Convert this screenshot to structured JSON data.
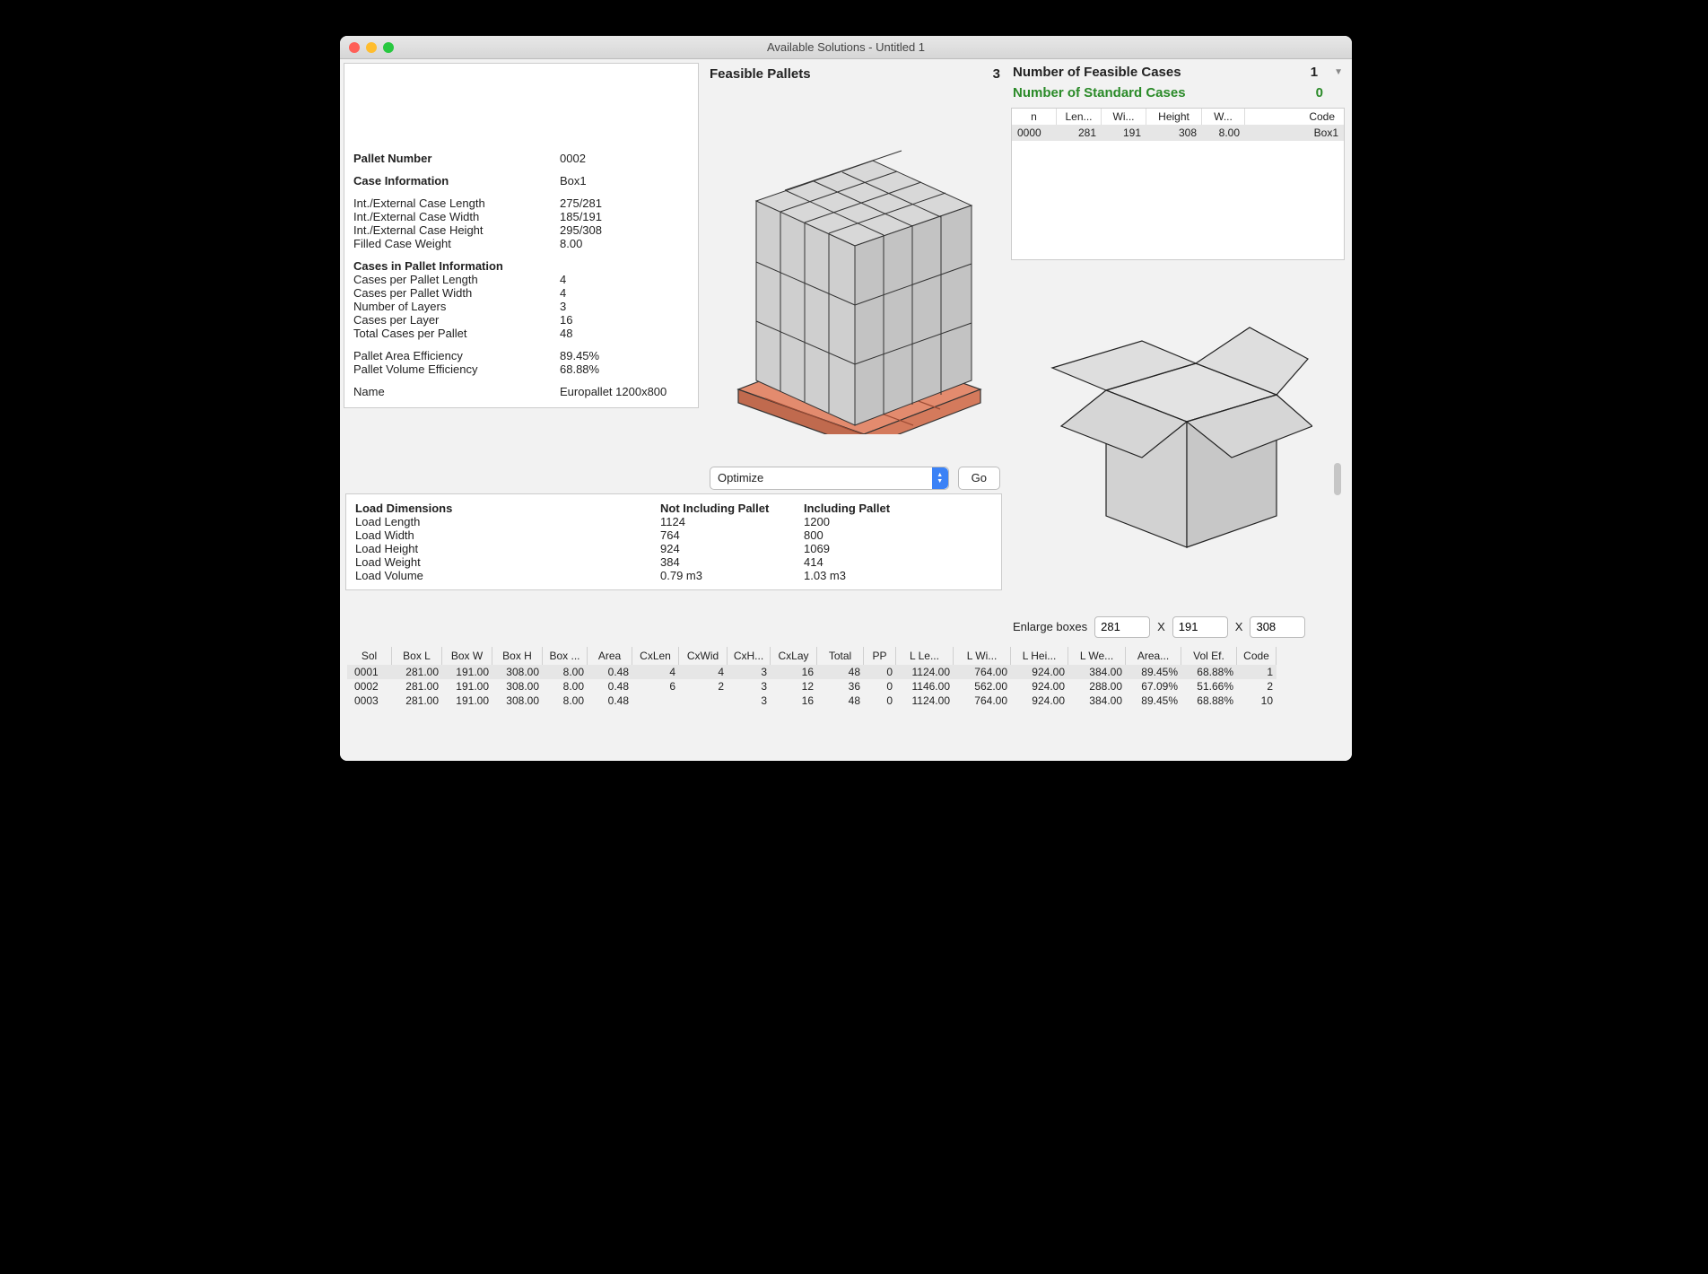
{
  "window": {
    "title": "Available Solutions - Untitled 1"
  },
  "left": {
    "pallet_number_lbl": "Pallet Number",
    "pallet_number": "0002",
    "case_info_lbl": "Case Information",
    "case_info": "Box1",
    "len_lbl": "Int./External Case Length",
    "len_val": "275/281",
    "wid_lbl": "Int./External Case Width",
    "wid_val": "185/191",
    "hei_lbl": "Int./External Case Height",
    "hei_val": "295/308",
    "fcw_lbl": "Filled Case Weight",
    "fcw_val": "8.00",
    "cip_lbl": "Cases in Pallet Information",
    "cpl_lbl": "Cases per Pallet Length",
    "cpl_val": "4",
    "cpw_lbl": "Cases per Pallet Width",
    "cpw_val": "4",
    "nol_lbl": "Number of Layers",
    "nol_val": "3",
    "cplay_lbl": "Cases per Layer",
    "cplay_val": "16",
    "tcpp_lbl": "Total Cases per Pallet",
    "tcpp_val": "48",
    "pae_lbl": "Pallet Area Efficiency",
    "pae_val": "89.45%",
    "pve_lbl": "Pallet Volume Efficiency",
    "pve_val": "68.88%",
    "name_lbl": "Name",
    "name_val": "Europallet 1200x800"
  },
  "load": {
    "hdr": "Load Dimensions",
    "not_inc": "Not Including Pallet",
    "inc": "Including Pallet",
    "rows": {
      "len": {
        "lbl": "Load Length",
        "a": "1124",
        "b": "1200"
      },
      "wid": {
        "lbl": "Load Width",
        "a": "764",
        "b": "800"
      },
      "hei": {
        "lbl": "Load Height",
        "a": "924",
        "b": "1069"
      },
      "wei": {
        "lbl": "Load Weight",
        "a": "384",
        "b": "414"
      },
      "vol": {
        "lbl": "Load Volume",
        "a": "0.79 m3",
        "b": "1.03 m3"
      }
    }
  },
  "mid": {
    "header": "Feasible Pallets",
    "count": "3",
    "optimize_label": "Optimize",
    "go_label": "Go"
  },
  "right": {
    "feas_lbl": "Number of Feasible Cases",
    "feas_val": "1",
    "std_lbl": "Number of Standard Cases",
    "std_val": "0",
    "case_table": {
      "headers": {
        "n": "n",
        "len": "Len...",
        "wi": "Wi...",
        "height": "Height",
        "w": "W...",
        "code": "Code"
      },
      "row": {
        "n": "0000",
        "len": "281",
        "wi": "191",
        "height": "308",
        "w": "8.00",
        "code": "Box1"
      }
    },
    "enlarge_lbl": "Enlarge boxes",
    "enlarge": {
      "l": "281",
      "w": "191",
      "h": "308"
    },
    "x": "X"
  },
  "sol": {
    "headers": [
      "Sol",
      "Box L",
      "Box W",
      "Box H",
      "Box ...",
      "Area",
      "CxLen",
      "CxWid",
      "CxH...",
      "CxLay",
      "Total",
      "PP",
      "L Le...",
      "L Wi...",
      "L Hei...",
      "L We...",
      "Area...",
      "Vol Ef.",
      "Code"
    ],
    "rows": [
      [
        "0001",
        "281.00",
        "191.00",
        "308.00",
        "8.00",
        "0.48",
        "4",
        "4",
        "3",
        "16",
        "48",
        "0",
        "1124.00",
        "764.00",
        "924.00",
        "384.00",
        "89.45%",
        "68.88%",
        "1"
      ],
      [
        "0002",
        "281.00",
        "191.00",
        "308.00",
        "8.00",
        "0.48",
        "6",
        "2",
        "3",
        "12",
        "36",
        "0",
        "1146.00",
        "562.00",
        "924.00",
        "288.00",
        "67.09%",
        "51.66%",
        "2"
      ],
      [
        "0003",
        "281.00",
        "191.00",
        "308.00",
        "8.00",
        "0.48",
        "",
        "",
        "3",
        "16",
        "48",
        "0",
        "1124.00",
        "764.00",
        "924.00",
        "384.00",
        "89.45%",
        "68.88%",
        "10"
      ]
    ]
  },
  "chart_data": {
    "type": "table",
    "title": "Pallet load solutions",
    "columns": [
      "Sol",
      "Box L",
      "Box W",
      "Box H",
      "Box Weight",
      "Area",
      "CxLen",
      "CxWid",
      "CxHeight",
      "CxLay",
      "Total",
      "PP",
      "L Length",
      "L Width",
      "L Height",
      "L Weight",
      "Area Eff",
      "Vol Eff",
      "Code"
    ],
    "rows": [
      [
        "0001",
        281.0,
        191.0,
        308.0,
        8.0,
        0.48,
        4,
        4,
        3,
        16,
        48,
        0,
        1124.0,
        764.0,
        924.0,
        384.0,
        "89.45%",
        "68.88%",
        1
      ],
      [
        "0002",
        281.0,
        191.0,
        308.0,
        8.0,
        0.48,
        6,
        2,
        3,
        12,
        36,
        0,
        1146.0,
        562.0,
        924.0,
        288.0,
        "67.09%",
        "51.66%",
        2
      ],
      [
        "0003",
        281.0,
        191.0,
        308.0,
        8.0,
        0.48,
        null,
        null,
        3,
        16,
        48,
        0,
        1124.0,
        764.0,
        924.0,
        384.0,
        "89.45%",
        "68.88%",
        10
      ]
    ]
  }
}
